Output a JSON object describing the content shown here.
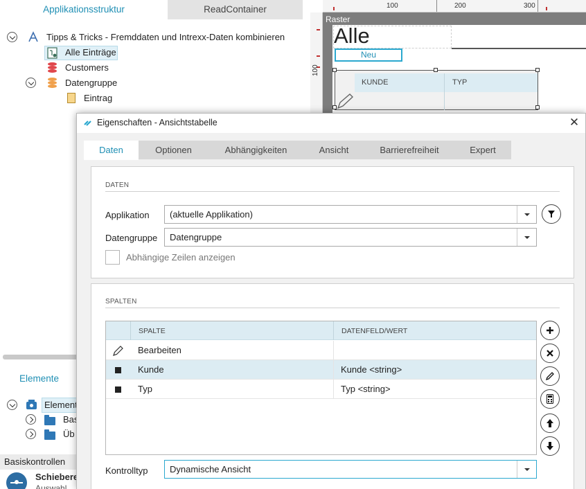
{
  "app_structure": {
    "tabs": [
      "Applikationsstruktur",
      "ReadContainer"
    ],
    "tree": {
      "root": "Tipps & Tricks - Fremddaten und Intrexx-Daten kombinieren",
      "items": [
        "Alle Einträge",
        "Customers",
        "Datengruppe"
      ],
      "child": "Eintrag"
    }
  },
  "elements_panel": {
    "title": "Elemente",
    "root": "Element",
    "items": [
      "Bas",
      "Üb"
    ]
  },
  "basis": {
    "title": "Basiskontrollen",
    "item_title": "Schiebere",
    "item_sub": "Auswahl"
  },
  "designer": {
    "ruler_top": [
      "100",
      "200",
      "300"
    ],
    "ruler_left": [
      "100"
    ],
    "raster_label": "Raster",
    "heading": "Alle",
    "button": "Neu",
    "table_cols": [
      "KUNDE",
      "TYP"
    ]
  },
  "dialog": {
    "title": "Eigenschaften - Ansichtstabelle",
    "tabs": [
      "Daten",
      "Optionen",
      "Abhängigkeiten",
      "Ansicht",
      "Barrierefreiheit",
      "Expert"
    ],
    "daten": {
      "title": "DATEN",
      "applikation_label": "Applikation",
      "applikation_value": "(aktuelle Applikation)",
      "datengruppe_label": "Datengruppe",
      "datengruppe_value": "Datengruppe",
      "checkbox_label": "Abhängige Zeilen anzeigen"
    },
    "spalten": {
      "title": "SPALTEN",
      "headers": [
        "SPALTE",
        "DATENFELD/WERT"
      ],
      "rows": [
        {
          "spalte": "Bearbeiten",
          "wert": ""
        },
        {
          "spalte": "Kunde",
          "wert": "Kunde <string>"
        },
        {
          "spalte": "Typ",
          "wert": "Typ <string>"
        }
      ],
      "kontrolltyp_label": "Kontrolltyp",
      "kontrolltyp_value": "Dynamische Ansicht"
    }
  },
  "colors": {
    "accent": "#1f8fb4",
    "header_bg": "#dcecf3",
    "selected_row": "#dcecf3"
  }
}
